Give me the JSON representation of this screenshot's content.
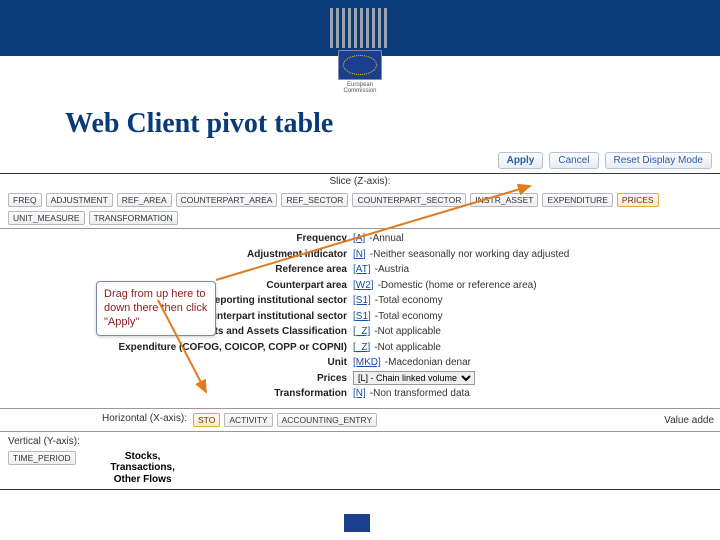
{
  "header": {
    "org": "European Commission"
  },
  "title": "Web Client pivot table",
  "toolbar": {
    "apply": "Apply",
    "cancel": "Cancel",
    "reset": "Reset Display Mode"
  },
  "slice": {
    "label": "Slice (Z-axis):",
    "chips": [
      {
        "key": "FREQ",
        "label": "FREQ",
        "hot": false
      },
      {
        "key": "ADJUSTMENT",
        "label": "ADJUSTMENT",
        "hot": false
      },
      {
        "key": "REF_AREA",
        "label": "REF_AREA",
        "hot": false
      },
      {
        "key": "COUNTERPART_AREA",
        "label": "COUNTERPART_AREA",
        "hot": false
      },
      {
        "key": "REF_SECTOR",
        "label": "REF_SECTOR",
        "hot": false
      },
      {
        "key": "COUNTERPART_SECTOR",
        "label": "COUNTERPART_SECTOR",
        "hot": false
      },
      {
        "key": "INSTR_ASSET",
        "label": "INSTR_ASSET",
        "hot": false
      },
      {
        "key": "EXPENDITURE",
        "label": "EXPENDITURE",
        "hot": false
      },
      {
        "key": "PRICES",
        "label": "PRICES",
        "hot": true
      },
      {
        "key": "UNIT_MEASURE",
        "label": "UNIT_MEASURE",
        "hot": false
      },
      {
        "key": "TRANSFORMATION",
        "label": "TRANSFORMATION",
        "hot": false
      }
    ]
  },
  "fields": [
    {
      "label": "Frequency",
      "code": "[A]",
      "value": "Annual"
    },
    {
      "label": "Adjustment indicator",
      "code": "[N]",
      "value": "Neither seasonally nor working day adjusted"
    },
    {
      "label": "Reference area",
      "code": "[AT]",
      "value": "Austria"
    },
    {
      "label": "Counterpart area",
      "code": "[W2]",
      "value": "Domestic (home or reference area)"
    },
    {
      "label": "Reporting institutional sector",
      "code": "[S1]",
      "value": "Total economy"
    },
    {
      "label": "Counterpart institutional sector",
      "code": "[S1]",
      "value": "Total economy"
    },
    {
      "label": "Instruments and Assets Classification",
      "code": "[_Z]",
      "value": "Not applicable"
    },
    {
      "label": "Expenditure (COFOG, COICOP, COPP or COPNI)",
      "code": "[_Z]",
      "value": "Not applicable"
    },
    {
      "label": "Unit",
      "code": "[MKD]",
      "value": "Macedonian denar"
    },
    {
      "label": "Prices",
      "code": "",
      "value": "[L] - Chain linked volume",
      "select": true
    },
    {
      "label": "Transformation",
      "code": "[N]",
      "value": "Non transformed data"
    }
  ],
  "callout": {
    "text": "Drag from up here to down there then click \"Apply\""
  },
  "xaxis": {
    "label": "Horizontal (X-axis):",
    "chips": [
      {
        "label": "STO",
        "hot": true
      },
      {
        "label": "ACTIVITY",
        "hot": false
      },
      {
        "label": "ACCOUNTING_ENTRY",
        "hot": false
      }
    ]
  },
  "yaxis": {
    "label": "Vertical (Y-axis):",
    "chip": {
      "label": "TIME_PERIOD",
      "hot": false
    },
    "column_header": "Stocks, Transactions, Other Flows"
  },
  "right_text": "Value adde"
}
